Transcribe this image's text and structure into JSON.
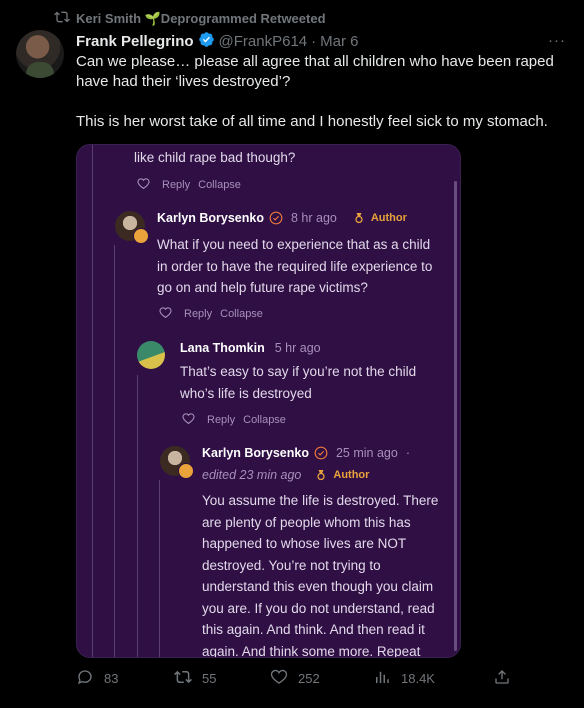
{
  "retweet": {
    "text": "Keri Smith 🌱Deprogrammed Retweeted"
  },
  "tweet": {
    "name": "Frank Pellegrino",
    "handle": "@FrankP614",
    "date": "Mar 6",
    "paragraphs": [
      "Can we please… please all agree that all children who have been raped have had their ‘lives destroyed’?",
      "This is her worst take of all time and I honestly feel sick to my stomach."
    ]
  },
  "embed": {
    "top_comment": {
      "text": "like child rape bad though?",
      "reply": "Reply",
      "collapse": "Collapse"
    },
    "comment1": {
      "name": "Karlyn Borysenko",
      "time": "8 hr ago",
      "author": "Author",
      "lines": [
        "What if you need to experience that as a child",
        "in order to have the required life experience to",
        "go on and help future rape victims?"
      ],
      "reply": "Reply",
      "collapse": "Collapse"
    },
    "comment2": {
      "name": "Lana Thomkin",
      "time": "5 hr ago",
      "lines": [
        "That’s easy to say if you’re not the child",
        "who’s life is destroyed"
      ],
      "reply": "Reply",
      "collapse": "Collapse"
    },
    "comment3": {
      "name": "Karlyn Borysenko",
      "time": "25 min ago",
      "dot": "·",
      "edited": "edited 23 min ago",
      "author": "Author",
      "lines": [
        "You assume the life is destroyed. There",
        "are plenty of people whom this has",
        "happened to whose lives are NOT",
        "destroyed. You’re not trying to",
        "understand this even though you claim",
        "you are. If you do not understand, read",
        "this again. And think. And then read it",
        "again. And think some more. Repeat"
      ]
    }
  },
  "actions": {
    "replies": "83",
    "retweets": "55",
    "likes": "252",
    "views": "18.4K"
  },
  "colors": {
    "background": "#000000",
    "embed_bg": "#2f0f44",
    "accent_author": "#e9a33a",
    "verified": "#1d9bf0"
  }
}
